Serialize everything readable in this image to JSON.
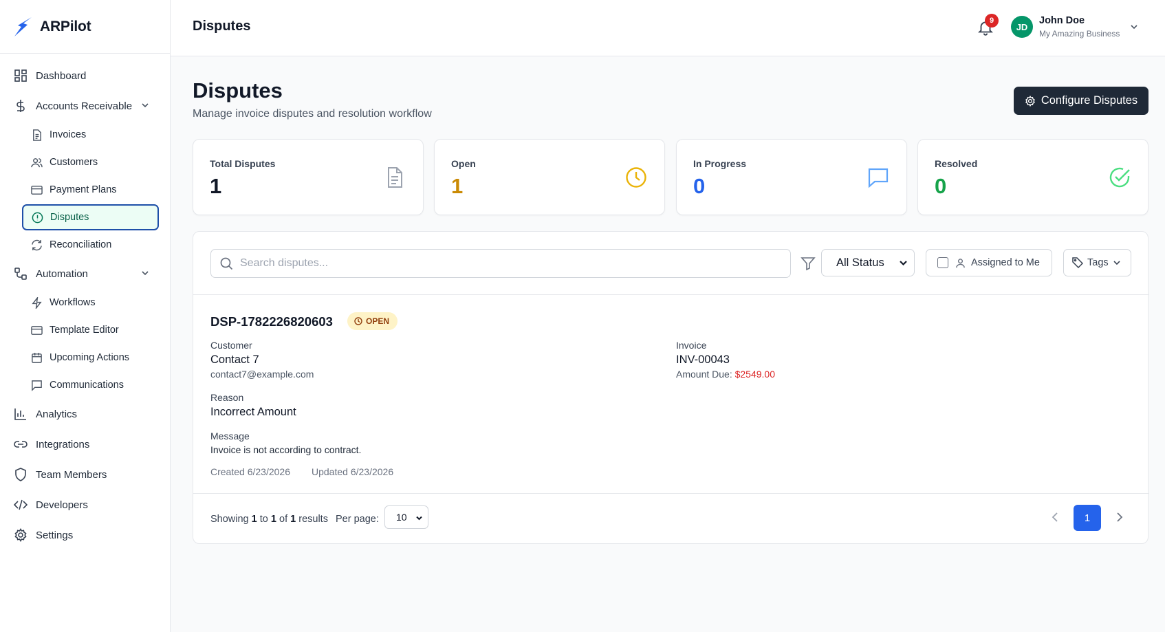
{
  "brand": {
    "name": "ARPilot"
  },
  "sidebar": {
    "dashboard": "Dashboard",
    "accounts_receivable": "Accounts Receivable",
    "ar_items": [
      "Invoices",
      "Customers",
      "Payment Plans",
      "Disputes",
      "Reconciliation"
    ],
    "automation": "Automation",
    "automation_items": [
      "Workflows",
      "Template Editor",
      "Upcoming Actions",
      "Communications"
    ],
    "analytics": "Analytics",
    "integrations": "Integrations",
    "team_members": "Team Members",
    "developers": "Developers",
    "settings": "Settings"
  },
  "header": {
    "title": "Disputes",
    "notification_count": "9",
    "user_initials": "JD",
    "user_name": "John Doe",
    "user_business": "My Amazing Business"
  },
  "page": {
    "title": "Disputes",
    "subtitle": "Manage invoice disputes and resolution workflow",
    "configure_label": "Configure Disputes"
  },
  "stats": [
    {
      "label": "Total Disputes",
      "value": "1",
      "color": "#111827",
      "icon": "document-icon"
    },
    {
      "label": "Open",
      "value": "1",
      "color": "#ca8a04",
      "icon": "clock-icon"
    },
    {
      "label": "In Progress",
      "value": "0",
      "color": "#2563eb",
      "icon": "chat-icon"
    },
    {
      "label": "Resolved",
      "value": "0",
      "color": "#16a34a",
      "icon": "check-circle-icon"
    }
  ],
  "filters": {
    "search_placeholder": "Search disputes...",
    "status_value": "All Status",
    "assigned_label": "Assigned to Me",
    "tags_label": "Tags"
  },
  "dispute": {
    "id": "DSP-1782226820603",
    "status": "OPEN",
    "customer_label": "Customer",
    "customer_name": "Contact 7",
    "customer_email": "contact7@example.com",
    "invoice_label": "Invoice",
    "invoice_number": "INV-00043",
    "amount_due_label": "Amount Due:",
    "amount_due": "$2549.00",
    "reason_label": "Reason",
    "reason": "Incorrect Amount",
    "message_label": "Message",
    "message": "Invoice is not according to contract.",
    "created": "Created 6/23/2026",
    "updated": "Updated 6/23/2026"
  },
  "pagination": {
    "showing_prefix": "Showing",
    "from": "1",
    "to_word": "to",
    "to": "1",
    "of_word": "of",
    "total": "1",
    "results_word": "results",
    "per_page_label": "Per page:",
    "per_page_value": "10",
    "current_page": "1"
  }
}
